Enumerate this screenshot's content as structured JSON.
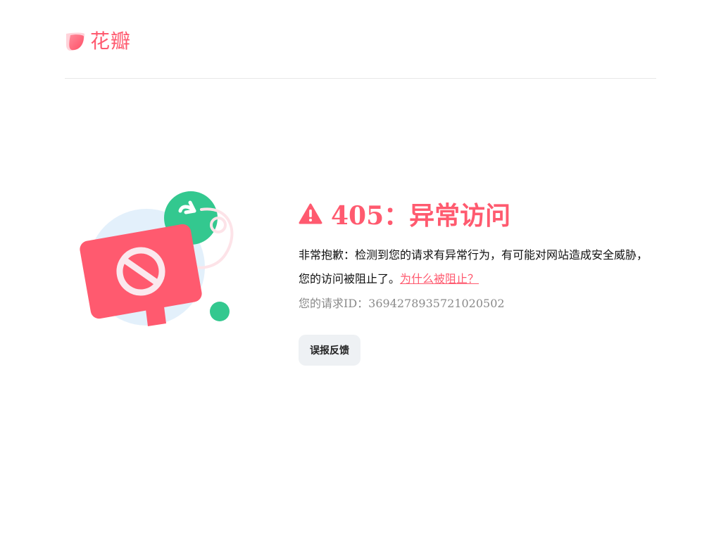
{
  "header": {
    "logo_text": "花瓣",
    "logo_icon": "petal-logo-icon"
  },
  "error": {
    "code_title": "405：异常访问",
    "icon": "warning-triangle-icon",
    "description": "非常抱歉：检测到您的请求有异常行为，有可能对网站造成安全威胁，您的访问被阻止了。",
    "why_link": "为什么被阻止？",
    "request_id_label": "您的请求ID：",
    "request_id": "3694278935721020502",
    "feedback_button": "误报反馈"
  },
  "illustration": {
    "icon": "blocked-sign-illustration"
  },
  "colors": {
    "accent": "#ff5a6f",
    "green": "#33c88f",
    "light_blue": "#e3f0fb",
    "button_bg": "#eef1f4",
    "muted_text": "#8a8a8a"
  }
}
